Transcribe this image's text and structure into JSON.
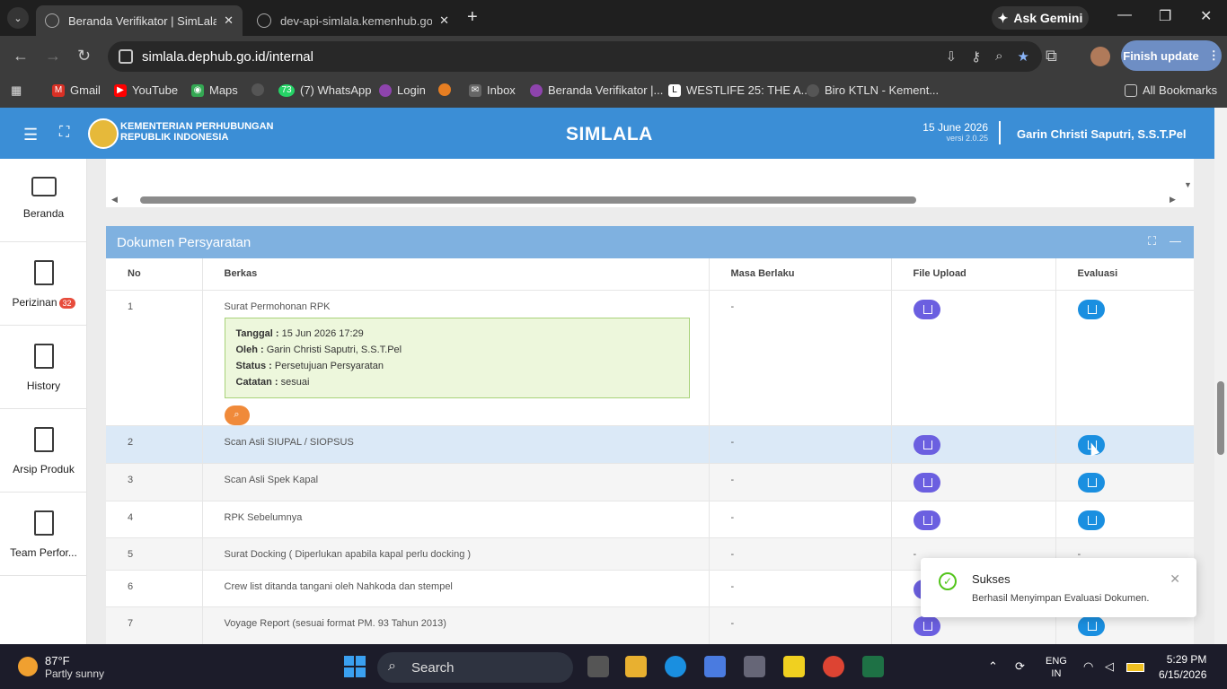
{
  "browser": {
    "tabs": [
      {
        "title": "Beranda Verifikator | SimLala",
        "active": true
      },
      {
        "title": "dev-api-simlala.kemenhub.go.id",
        "active": false
      }
    ],
    "gemini_label": "Ask Gemini",
    "url": "simlala.dephub.go.id/internal",
    "finish_update": "Finish update",
    "bookmarks": [
      "Gmail",
      "YouTube",
      "Maps",
      "(7) WhatsApp",
      "Login",
      "Inbox",
      "Beranda Verifikator |...",
      "WESTLIFE 25: THE A...",
      "Biro KTLN - Kement..."
    ],
    "whatsapp_badge": "73",
    "all_bookmarks": "All Bookmarks"
  },
  "header": {
    "org_line1": "KEMENTERIAN PERHUBUNGAN",
    "org_line2": "REPUBLIK INDONESIA",
    "brand": "SIMLALA",
    "date": "15 June 2026",
    "version": "versi 2.0.25",
    "user": "Garin Christi Saputri, S.S.T.Pel"
  },
  "sidebar": {
    "items": [
      {
        "label": "Beranda",
        "icon": "monitor-icon"
      },
      {
        "label": "Perizinan",
        "icon": "document-icon",
        "badge": "32"
      },
      {
        "label": "History",
        "icon": "document-icon"
      },
      {
        "label": "Arsip Produk",
        "icon": "document-icon"
      },
      {
        "label": "Team Perfor...",
        "icon": "document-icon"
      }
    ]
  },
  "panel": {
    "title": "Dokumen Persyaratan",
    "columns": [
      "No",
      "Berkas",
      "Masa Berlaku",
      "File Upload",
      "Evaluasi"
    ],
    "rows": [
      {
        "no": "1",
        "berkas": "Surat Permohonan RPK",
        "masa": "-",
        "upload": "download",
        "evaluasi": "edit"
      },
      {
        "no": "2",
        "berkas": "Scan Asli SIUPAL / SIOPSUS",
        "masa": "-",
        "upload": "download",
        "evaluasi": "edit"
      },
      {
        "no": "3",
        "berkas": "Scan Asli Spek Kapal",
        "masa": "-",
        "upload": "download",
        "evaluasi": "edit"
      },
      {
        "no": "4",
        "berkas": "RPK Sebelumnya",
        "masa": "-",
        "upload": "download",
        "evaluasi": "edit"
      },
      {
        "no": "5",
        "berkas": "Surat Docking ( Diperlukan apabila kapal perlu docking )",
        "masa": "-",
        "upload": "-",
        "evaluasi": "-"
      },
      {
        "no": "6",
        "berkas": "Crew list ditanda tangani oleh Nahkoda dan stempel",
        "masa": "-",
        "upload": "download",
        "evaluasi": "edit"
      },
      {
        "no": "7",
        "berkas": "Voyage Report (sesuai format PM. 93 Tahun 2013)",
        "masa": "-",
        "upload": "download",
        "evaluasi": "edit"
      }
    ],
    "info": {
      "tanggal_label": "Tanggal :",
      "tanggal": "15 Jun 2026 17:29",
      "oleh_label": "Oleh :",
      "oleh": "Garin Christi Saputri, S.S.T.Pel",
      "status_label": "Status :",
      "status": "Persetujuan Persyaratan",
      "catatan_label": "Catatan :",
      "catatan": "sesuai"
    }
  },
  "toast": {
    "title": "Sukses",
    "message": "Berhasil Menyimpan Evaluasi Dokumen."
  },
  "taskbar": {
    "temp": "87°F",
    "weather": "Partly sunny",
    "search": "Search",
    "lang1": "ENG",
    "lang2": "IN",
    "time": "5:29 PM",
    "date": "6/15/2026"
  }
}
